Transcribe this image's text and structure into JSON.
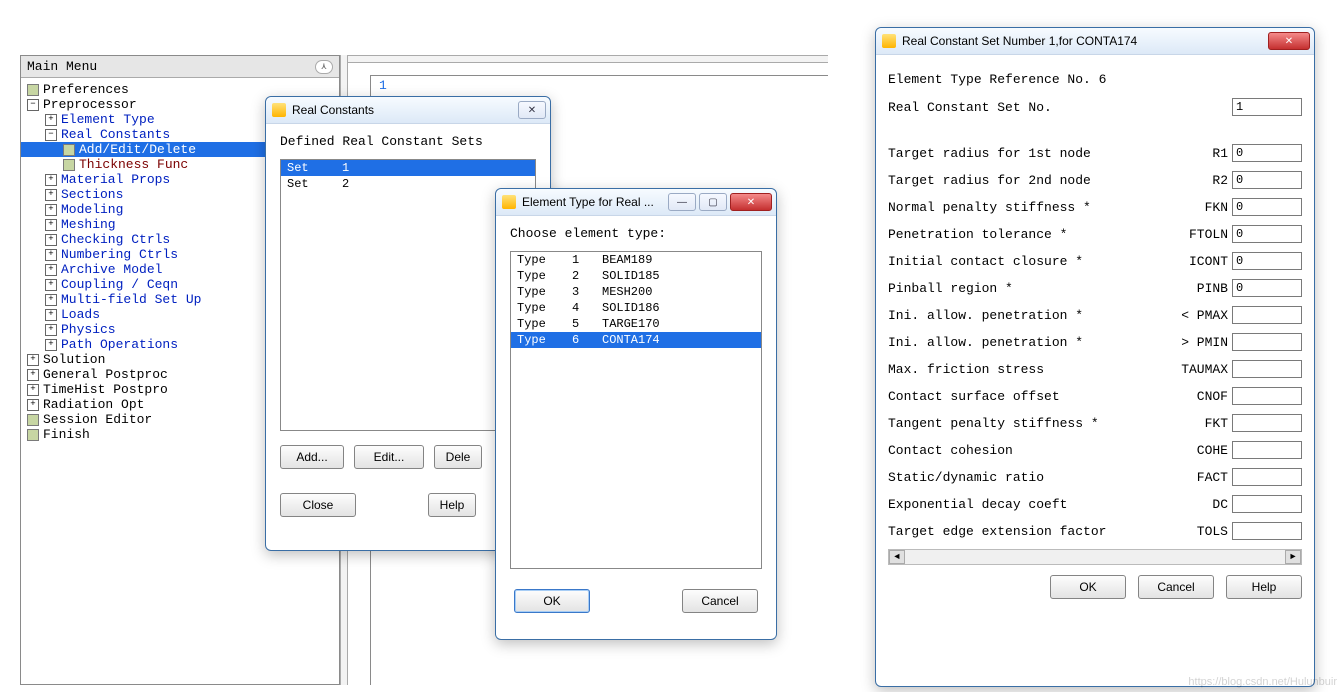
{
  "main_menu": {
    "title": "Main Menu",
    "tree": [
      {
        "d": 0,
        "ico": "leaf",
        "label": "Preferences",
        "cls": "black"
      },
      {
        "d": 0,
        "ico": "minus",
        "label": "Preprocessor",
        "cls": "black"
      },
      {
        "d": 1,
        "ico": "plus",
        "label": "Element Type",
        "cls": "blue"
      },
      {
        "d": 1,
        "ico": "minus",
        "label": "Real Constants",
        "cls": "blue"
      },
      {
        "d": 2,
        "ico": "leaf",
        "label": "Add/Edit/Delete",
        "cls": "maroon",
        "selected": true
      },
      {
        "d": 2,
        "ico": "leaf",
        "label": "Thickness Func",
        "cls": "maroon"
      },
      {
        "d": 1,
        "ico": "plus",
        "label": "Material Props",
        "cls": "blue"
      },
      {
        "d": 1,
        "ico": "plus",
        "label": "Sections",
        "cls": "blue"
      },
      {
        "d": 1,
        "ico": "plus",
        "label": "Modeling",
        "cls": "blue"
      },
      {
        "d": 1,
        "ico": "plus",
        "label": "Meshing",
        "cls": "blue"
      },
      {
        "d": 1,
        "ico": "plus",
        "label": "Checking Ctrls",
        "cls": "blue"
      },
      {
        "d": 1,
        "ico": "plus",
        "label": "Numbering Ctrls",
        "cls": "blue"
      },
      {
        "d": 1,
        "ico": "plus",
        "label": "Archive Model",
        "cls": "blue"
      },
      {
        "d": 1,
        "ico": "plus",
        "label": "Coupling / Ceqn",
        "cls": "blue"
      },
      {
        "d": 1,
        "ico": "plus",
        "label": "Multi-field Set Up",
        "cls": "blue"
      },
      {
        "d": 1,
        "ico": "plus",
        "label": "Loads",
        "cls": "blue"
      },
      {
        "d": 1,
        "ico": "plus",
        "label": "Physics",
        "cls": "blue"
      },
      {
        "d": 1,
        "ico": "plus",
        "label": "Path Operations",
        "cls": "blue"
      },
      {
        "d": 0,
        "ico": "plus",
        "label": "Solution",
        "cls": "black"
      },
      {
        "d": 0,
        "ico": "plus",
        "label": "General Postproc",
        "cls": "black"
      },
      {
        "d": 0,
        "ico": "plus",
        "label": "TimeHist Postpro",
        "cls": "black"
      },
      {
        "d": 0,
        "ico": "plus",
        "label": "Radiation Opt",
        "cls": "black"
      },
      {
        "d": 0,
        "ico": "leaf",
        "label": "Session Editor",
        "cls": "black"
      },
      {
        "d": 0,
        "ico": "leaf",
        "label": "Finish",
        "cls": "black"
      }
    ]
  },
  "editor": {
    "line_no": "1"
  },
  "real_constants_dlg": {
    "title": "Real Constants",
    "heading": "Defined Real Constant Sets",
    "rows": [
      {
        "a": "Set",
        "b": "1",
        "sel": true
      },
      {
        "a": "Set",
        "b": "2",
        "sel": false
      }
    ],
    "buttons": {
      "add": "Add...",
      "edit": "Edit...",
      "del": "Dele",
      "close": "Close",
      "help": "Help"
    }
  },
  "etype_dlg": {
    "title": "Element Type for Real ...",
    "heading": "Choose element type:",
    "rows": [
      {
        "a": "Type",
        "b": "1",
        "c": "BEAM189"
      },
      {
        "a": "Type",
        "b": "2",
        "c": "SOLID185"
      },
      {
        "a": "Type",
        "b": "3",
        "c": "MESH200"
      },
      {
        "a": "Type",
        "b": "4",
        "c": "SOLID186"
      },
      {
        "a": "Type",
        "b": "5",
        "c": "TARGE170"
      },
      {
        "a": "Type",
        "b": "6",
        "c": "CONTA174",
        "sel": true
      }
    ],
    "buttons": {
      "ok": "OK",
      "cancel": "Cancel"
    }
  },
  "rcset_dlg": {
    "title": "Real Constant Set Number 1,for CONTA174",
    "ref_line": "Element Type Reference No. 6",
    "setno_label": "Real Constant Set No.",
    "setno_value": "1",
    "fields": [
      {
        "lab": "Target radius for 1st node",
        "code": "R1",
        "val": "0"
      },
      {
        "lab": "Target radius for 2nd node",
        "code": "R2",
        "val": "0"
      },
      {
        "lab": "Normal penalty stiffness *",
        "code": "FKN",
        "val": "0"
      },
      {
        "lab": "Penetration tolerance *",
        "code": "FTOLN",
        "val": "0"
      },
      {
        "lab": "Initial contact closure *",
        "code": "ICONT",
        "val": "0"
      },
      {
        "lab": "Pinball region *",
        "code": "PINB",
        "val": "0"
      },
      {
        "lab": "Ini. allow. penetration *",
        "code": "< PMAX",
        "val": ""
      },
      {
        "lab": "Ini. allow. penetration *",
        "code": "> PMIN",
        "val": ""
      },
      {
        "lab": "Max. friction stress",
        "code": "TAUMAX",
        "val": ""
      },
      {
        "lab": "Contact surface offset",
        "code": "CNOF",
        "val": ""
      },
      {
        "lab": "Tangent penalty stiffness *",
        "code": "FKT",
        "val": ""
      },
      {
        "lab": "Contact cohesion",
        "code": "COHE",
        "val": ""
      },
      {
        "lab": "Static/dynamic ratio",
        "code": "FACT",
        "val": ""
      },
      {
        "lab": "Exponential decay coeft",
        "code": "DC",
        "val": ""
      },
      {
        "lab": "Target edge extension factor",
        "code": "TOLS",
        "val": ""
      }
    ],
    "buttons": {
      "ok": "OK",
      "cancel": "Cancel",
      "help": "Help"
    }
  },
  "watermark": "https://blog.csdn.net/Hulunbuir"
}
